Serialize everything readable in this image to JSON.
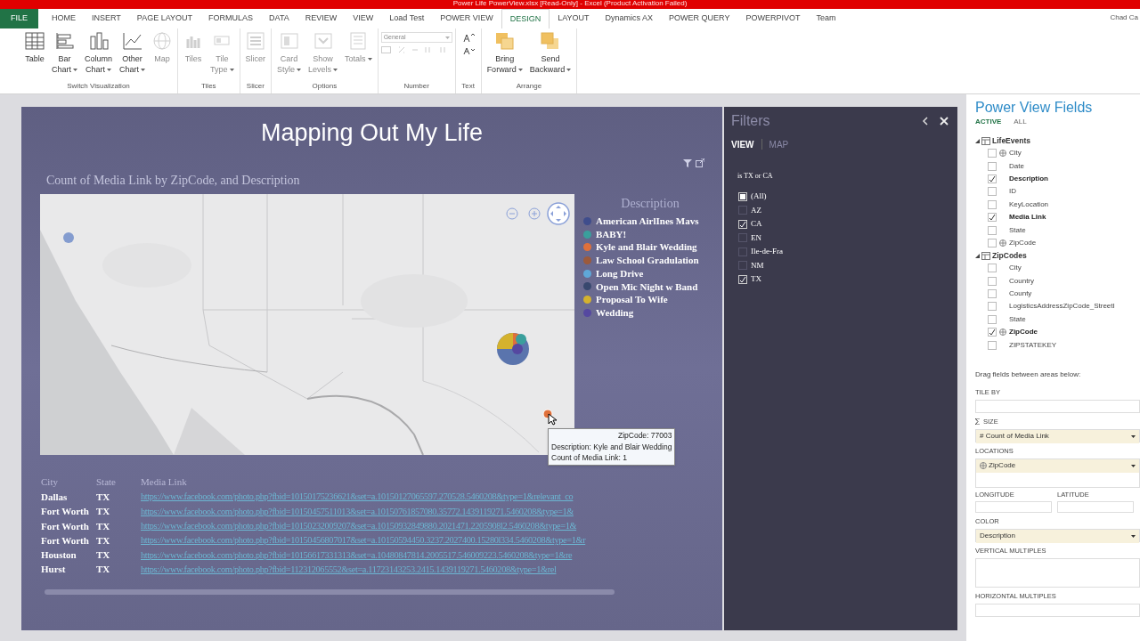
{
  "window": {
    "title": "Power Life PowerView.xlsx [Read-Only] - Excel (Product Activation Failed)",
    "user": "Chad Ca"
  },
  "ribbon_tabs": [
    {
      "label": "FILE",
      "kind": "file",
      "selected": false
    },
    {
      "label": "HOME",
      "kind": "tab",
      "selected": false
    },
    {
      "label": "INSERT",
      "kind": "tab",
      "selected": false
    },
    {
      "label": "PAGE LAYOUT",
      "kind": "tab",
      "selected": false
    },
    {
      "label": "FORMULAS",
      "kind": "tab",
      "selected": false
    },
    {
      "label": "DATA",
      "kind": "tab",
      "selected": false
    },
    {
      "label": "REVIEW",
      "kind": "tab",
      "selected": false
    },
    {
      "label": "VIEW",
      "kind": "tab",
      "selected": false
    },
    {
      "label": "Load Test",
      "kind": "tab",
      "selected": false
    },
    {
      "label": "POWER VIEW",
      "kind": "tab",
      "selected": false
    },
    {
      "label": "DESIGN",
      "kind": "tab",
      "selected": true
    },
    {
      "label": "LAYOUT",
      "kind": "tab",
      "selected": false
    },
    {
      "label": "Dynamics AX",
      "kind": "tab",
      "selected": false
    },
    {
      "label": "POWER QUERY",
      "kind": "tab",
      "selected": false
    },
    {
      "label": "POWERPIVOT",
      "kind": "tab",
      "selected": false
    },
    {
      "label": "Team",
      "kind": "tab",
      "selected": false
    }
  ],
  "ribbon_groups": [
    {
      "label": "Switch Visualization",
      "buttons": [
        {
          "kind": "table",
          "lines": [
            "Table"
          ],
          "menu": false,
          "disabled": false
        },
        {
          "kind": "bar",
          "lines": [
            "Bar",
            "Chart"
          ],
          "menu": true,
          "disabled": false
        },
        {
          "kind": "column",
          "lines": [
            "Column",
            "Chart"
          ],
          "menu": true,
          "disabled": false
        },
        {
          "kind": "line",
          "lines": [
            "Other",
            "Chart"
          ],
          "menu": true,
          "disabled": false
        },
        {
          "kind": "globe",
          "lines": [
            "Map"
          ],
          "menu": false,
          "disabled": true
        }
      ]
    },
    {
      "label": "Tiles",
      "buttons": [
        {
          "kind": "tiles",
          "lines": [
            "Tiles"
          ],
          "menu": false,
          "disabled": true
        },
        {
          "kind": "tiletype",
          "lines": [
            "Tile",
            "Type"
          ],
          "menu": true,
          "disabled": true
        }
      ]
    },
    {
      "label": "Slicer",
      "buttons": [
        {
          "kind": "slicer",
          "lines": [
            "Slicer"
          ],
          "menu": false,
          "disabled": true
        }
      ]
    },
    {
      "label": "Options",
      "buttons": [
        {
          "kind": "card",
          "lines": [
            "Card",
            "Style"
          ],
          "menu": true,
          "disabled": true
        },
        {
          "kind": "levels",
          "lines": [
            "Show",
            "Levels"
          ],
          "menu": true,
          "disabled": true
        },
        {
          "kind": "totals",
          "lines": [
            "Totals"
          ],
          "menu": true,
          "disabled": true
        }
      ]
    },
    {
      "label": "Number",
      "buttons": [
        {
          "kind": "number",
          "lines": [
            "General"
          ],
          "menu": true,
          "disabled": true
        }
      ]
    },
    {
      "label": "Text",
      "buttons": [
        {
          "kind": "fontsize"
        }
      ]
    },
    {
      "label": "Arrange",
      "buttons": [
        {
          "kind": "forward",
          "lines": [
            "Bring",
            "Forward"
          ],
          "menu": true,
          "disabled": false
        },
        {
          "kind": "backward",
          "lines": [
            "Send",
            "Backward"
          ],
          "menu": true,
          "disabled": false
        }
      ]
    }
  ],
  "report": {
    "title": "Mapping Out My Life",
    "map": {
      "title": "Count of Media Link by ZipCode, and Description",
      "legend_title": "Description",
      "legend": [
        {
          "label": "American AirlInes Mavs",
          "color": "#3f4d8c"
        },
        {
          "label": "BABY!",
          "color": "#3a9f9c"
        },
        {
          "label": "Kyle and Blair Wedding",
          "color": "#e0703a"
        },
        {
          "label": "Law School Gradulation",
          "color": "#9c5a3c"
        },
        {
          "label": "Long Drive",
          "color": "#5fa8d8"
        },
        {
          "label": "Open Mic Night w Band",
          "color": "#38486e"
        },
        {
          "label": "Proposal To Wife",
          "color": "#d4b22e"
        },
        {
          "label": "Wedding",
          "color": "#5548a0"
        }
      ],
      "tooltip": [
        "ZipCode: 77003",
        "Description: Kyle and Blair Wedding",
        "Count of Media Link: 1"
      ]
    },
    "table": {
      "columns": [
        "City",
        "State",
        "Media Link"
      ],
      "rows": [
        [
          "Dallas",
          "TX",
          "https://www.facebook.com/photo.php?fbid=10150175236621&set=a.10150127065597.270528.5460208&type=1&relevant_co"
        ],
        [
          "Fort Worth",
          "TX",
          "https://www.facebook.com/photo.php?fbid=10150457511013&set=a.10150761857080.35772.1439119271.5460208&type=1&"
        ],
        [
          "Fort Worth",
          "TX",
          "https://www.facebook.com/photo.php?fbid=10150232009207&set=a.10150932849880.2021471.2205908l2.5460208&type=1&"
        ],
        [
          "Fort Worth",
          "TX",
          "https://www.facebook.com/photo.php?fbid=10150456807017&set=a.10150594450.3237.2027400.15280l334.5460208&type=1&r"
        ],
        [
          "Houston",
          "TX",
          "https://www.facebook.com/photo.php?fbid=10156617331313&set=a.10480847814.2005517.546009223.5460208&type=1&re"
        ],
        [
          "Hurst",
          "TX",
          "https://www.facebook.com/photo.php?fbid=112312065552&set=a.11723143253.2415.1439119271.5460208&type=1&rel"
        ]
      ]
    }
  },
  "filters": {
    "title": "Filters",
    "tabs": [
      {
        "label": "VIEW",
        "selected": true
      },
      {
        "label": "MAP",
        "selected": false
      }
    ],
    "condition": "is TX or CA",
    "items": [
      {
        "label": "(All)",
        "checked": false,
        "partial": true
      },
      {
        "label": "AZ",
        "checked": false,
        "partial": false
      },
      {
        "label": "CA",
        "checked": true,
        "partial": false
      },
      {
        "label": "EN",
        "checked": false,
        "partial": false
      },
      {
        "label": "Ile-de-Fra",
        "checked": false,
        "partial": false
      },
      {
        "label": "NM",
        "checked": false,
        "partial": false
      },
      {
        "label": "TX",
        "checked": true,
        "partial": false
      }
    ]
  },
  "fields": {
    "title": "Power View Fields",
    "tabs": [
      {
        "label": "ACTIVE",
        "selected": true
      },
      {
        "label": "ALL",
        "selected": false
      }
    ],
    "tables": [
      {
        "name": "LifeEvents",
        "expanded": true,
        "children": [
          {
            "name": "City",
            "checked": false,
            "geo": true
          },
          {
            "name": "Date",
            "checked": false,
            "geo": false
          },
          {
            "name": "Description",
            "checked": true,
            "geo": false
          },
          {
            "name": "ID",
            "checked": false,
            "geo": false
          },
          {
            "name": "KeyLocation",
            "checked": false,
            "geo": false
          },
          {
            "name": "Media Link",
            "checked": true,
            "geo": false
          },
          {
            "name": "State",
            "checked": false,
            "geo": false
          },
          {
            "name": "ZipCode",
            "checked": false,
            "geo": true
          }
        ]
      },
      {
        "name": "ZipCodes",
        "expanded": true,
        "children": [
          {
            "name": "City",
            "checked": false,
            "geo": false
          },
          {
            "name": "Country",
            "checked": false,
            "geo": false
          },
          {
            "name": "County",
            "checked": false,
            "geo": false
          },
          {
            "name": "LogisticsAddressZipCode_StreetI",
            "checked": false,
            "geo": false
          },
          {
            "name": "State",
            "checked": false,
            "geo": false
          },
          {
            "name": "ZipCode",
            "checked": true,
            "geo": true
          },
          {
            "name": "ZIPSTATEKEY",
            "checked": false,
            "geo": false
          }
        ]
      }
    ],
    "hint": "Drag fields between areas below:",
    "areas": [
      {
        "label": "TILE BY",
        "kind": "single"
      },
      {
        "label": "SIZE",
        "kind": "sigma",
        "value": "# Count of Media Link"
      },
      {
        "label": "LOCATIONS",
        "kind": "tall",
        "value": "ZipCode",
        "geo": true
      },
      {
        "label": "LONGITUDE",
        "kind": "pair",
        "label2": "LATITUDE"
      },
      {
        "label": "COLOR",
        "kind": "single",
        "value": "Description"
      },
      {
        "label": "VERTICAL MULTIPLES",
        "kind": "tall"
      },
      {
        "label": "HORIZONTAL MULTIPLES",
        "kind": "single"
      }
    ]
  }
}
